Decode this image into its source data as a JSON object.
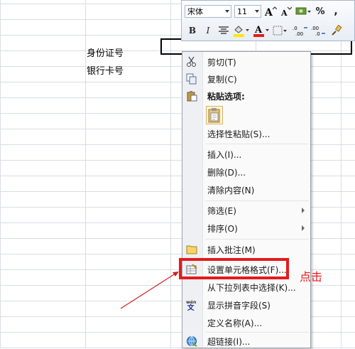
{
  "cells": {
    "id_number": "身份证号",
    "bank_card": "银行卡号"
  },
  "mini_toolbar": {
    "font_name": "宋体",
    "font_size": "11",
    "bold": "B",
    "italic": "I",
    "percent": "%",
    "comma": ","
  },
  "context_menu": {
    "cut": "剪切(T)",
    "copy": "复制(C)",
    "paste_options": "粘贴选项:",
    "paste_special": "选择性粘贴(S)...",
    "insert": "插入(I)...",
    "delete": "删除(D)...",
    "clear_contents": "清除内容(N)",
    "filter": "筛选(E)",
    "sort": "排序(O)",
    "insert_comment": "插入批注(M)",
    "format_cells": "设置单元格格式(F)...",
    "pick_from_list": "从下拉列表中选择(K)...",
    "show_phonetic": "显示拼音字段(S)",
    "define_name": "定义名称(A)...",
    "hyperlink": "超链接(I)..."
  },
  "annotation": {
    "click": "点击"
  },
  "colors": {
    "highlight": "#e31b1b",
    "font_color": "#e31b1b",
    "fill_color": "#ffe800"
  }
}
